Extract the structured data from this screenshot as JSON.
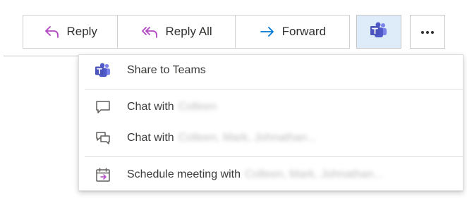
{
  "toolbar": {
    "reply_label": "Reply",
    "reply_all_label": "Reply All",
    "forward_label": "Forward"
  },
  "menu": {
    "items": [
      {
        "label": "Share to Teams",
        "icon": "teams-icon"
      },
      {
        "label": "Chat with",
        "recipients": "Colleen",
        "icon": "chat-icon"
      },
      {
        "label": "Chat with",
        "recipients": "Colleen, Mark, Johnathan...",
        "icon": "group-chat-icon"
      },
      {
        "label": "Schedule meeting with",
        "recipients": "Colleen, Mark, Johnathan...",
        "icon": "calendar-icon"
      }
    ]
  },
  "colors": {
    "reply_icon": "#b146c2",
    "forward_icon": "#0078d4",
    "teams_brand": "#5059c9",
    "teams_button_bg": "#deecf9"
  }
}
